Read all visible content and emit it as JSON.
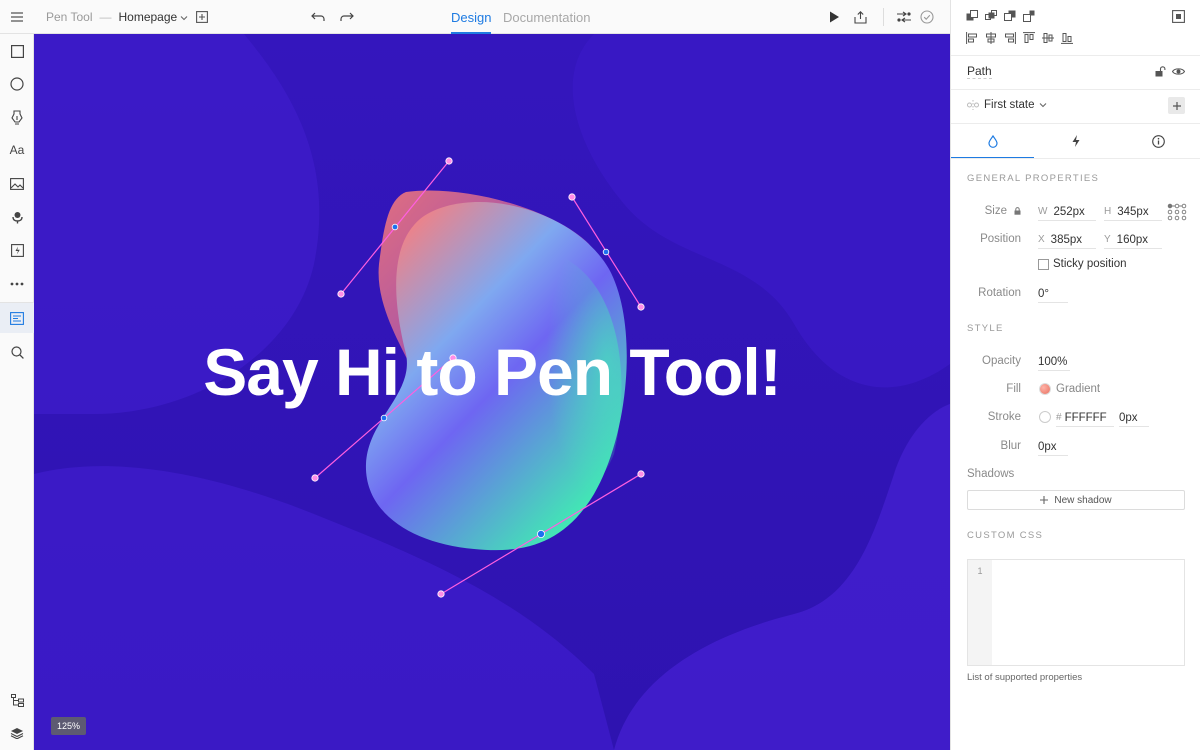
{
  "topbar": {
    "project": "Pen Tool",
    "separator": "—",
    "page": "Homepage",
    "tabs": [
      {
        "label": "Design",
        "active": true
      },
      {
        "label": "Documentation",
        "active": false
      }
    ],
    "accent_color": "#1e7be2"
  },
  "canvas": {
    "headline": "Say Hi to Pen Tool!",
    "zoom": "125%",
    "background_color": "#2a15b8"
  },
  "panel": {
    "layer_name": "Path",
    "state_name": "First state",
    "general_title": "GENERAL PROPERTIES",
    "size_label": "Size",
    "w_prefix": "W",
    "w_value": "252px",
    "h_prefix": "H",
    "h_value": "345px",
    "position_label": "Position",
    "x_prefix": "X",
    "x_value": "385px",
    "y_prefix": "Y",
    "y_value": "160px",
    "sticky_label": "Sticky position",
    "rotation_label": "Rotation",
    "rotation_value": "0°",
    "style_title": "STYLE",
    "opacity_label": "Opacity",
    "opacity_value": "100%",
    "fill_label": "Fill",
    "fill_value": "Gradient",
    "stroke_label": "Stroke",
    "stroke_hash": "#",
    "stroke_color": "FFFFFF",
    "stroke_width": "0px",
    "blur_label": "Blur",
    "blur_value": "0px",
    "shadows_label": "Shadows",
    "new_shadow_label": "New shadow",
    "css_title": "CUSTOM CSS",
    "css_line_number": "1",
    "css_note": "List of supported properties"
  }
}
